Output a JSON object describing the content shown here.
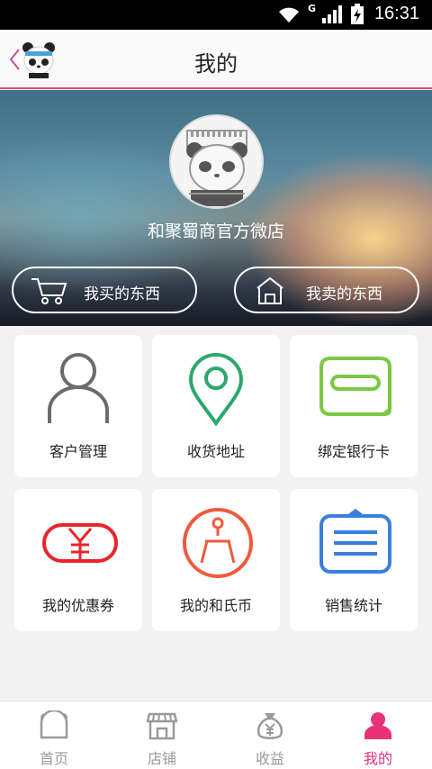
{
  "status_bar": {
    "time": "16:31",
    "network_type": "G"
  },
  "header": {
    "title": "我的",
    "back_icon": "chevron-left-icon",
    "logo": "panda-logo"
  },
  "profile": {
    "shop_name": "和聚蜀商官方微店"
  },
  "actions": [
    {
      "label": "我买的东西",
      "icon": "shopping-cart-icon"
    },
    {
      "label": "我卖的东西",
      "icon": "shop-icon"
    }
  ],
  "menu": [
    {
      "label": "客户管理",
      "icon": "person-icon",
      "color": "#6b6b6b"
    },
    {
      "label": "收货地址",
      "icon": "location-pin-icon",
      "color": "#2aa86e"
    },
    {
      "label": "绑定银行卡",
      "icon": "bank-card-icon",
      "color": "#7ac943"
    },
    {
      "label": "我的优惠券",
      "icon": "yen-coupon-icon",
      "color": "#e8262a"
    },
    {
      "label": "我的和氏币",
      "icon": "coin-icon",
      "color": "#f05a3c"
    },
    {
      "label": "销售统计",
      "icon": "report-icon",
      "color": "#3a7fdc"
    }
  ],
  "nav": [
    {
      "label": "首页",
      "icon": "home-panda-icon",
      "active": false
    },
    {
      "label": "店铺",
      "icon": "store-icon",
      "active": false
    },
    {
      "label": "收益",
      "icon": "money-bag-icon",
      "active": false
    },
    {
      "label": "我的",
      "icon": "profile-icon",
      "active": true
    }
  ],
  "colors": {
    "accent": "#e8317b",
    "header_line": "#e24a6a"
  }
}
